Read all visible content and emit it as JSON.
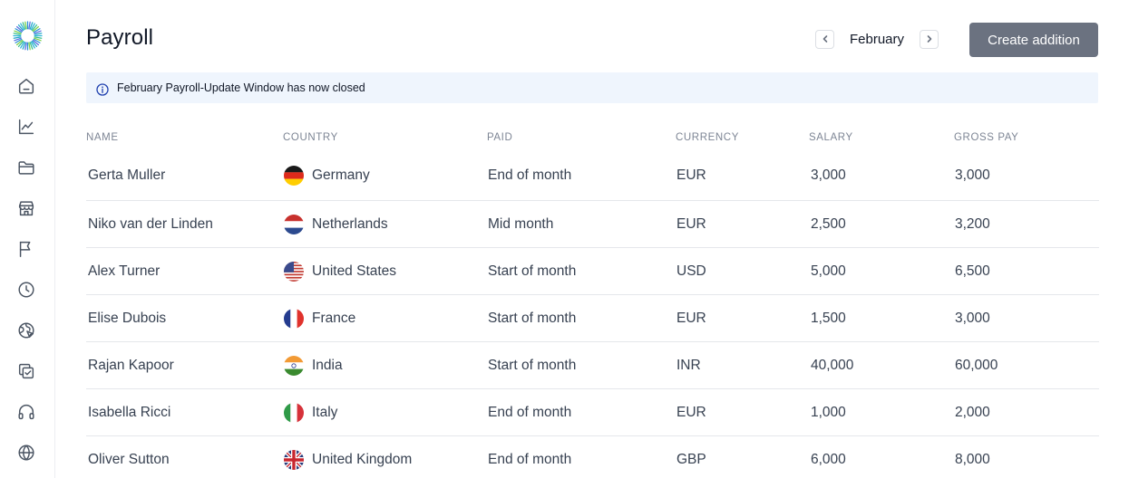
{
  "app": {
    "title": "Payroll"
  },
  "sidebar": {
    "logo": "sunburst-logo",
    "items": [
      {
        "name": "home",
        "icon": "home-icon"
      },
      {
        "name": "analytics",
        "icon": "chart-line-icon"
      },
      {
        "name": "documents",
        "icon": "folder-icon"
      },
      {
        "name": "store",
        "icon": "store-icon"
      },
      {
        "name": "flags",
        "icon": "flag-icon"
      },
      {
        "name": "time",
        "icon": "clock-icon"
      },
      {
        "name": "globe-analytics",
        "icon": "globe-pie-icon"
      },
      {
        "name": "approvals",
        "icon": "copy-check-icon"
      },
      {
        "name": "support",
        "icon": "headphones-icon"
      },
      {
        "name": "global",
        "icon": "globe-icon"
      }
    ]
  },
  "header": {
    "month": "February",
    "prev_icon": "chevron-left-icon",
    "next_icon": "chevron-right-icon",
    "create_label": "Create addition"
  },
  "banner": {
    "icon": "info-icon",
    "text": "February Payroll-Update Window has now closed"
  },
  "table": {
    "columns": [
      "NAME",
      "COUNTRY",
      "PAID",
      "CURRENCY",
      "SALARY",
      "GROSS PAY"
    ],
    "rows": [
      {
        "name": "Gerta Muller",
        "country": "Germany",
        "flag": "germany-flag",
        "paid": "End of month",
        "currency": "EUR",
        "salary": "3,000",
        "gross": "3,000"
      },
      {
        "name": "Niko van der Linden",
        "country": "Netherlands",
        "flag": "netherlands-flag",
        "paid": "Mid month",
        "currency": "EUR",
        "salary": "2,500",
        "gross": "3,200"
      },
      {
        "name": "Alex Turner",
        "country": "United States",
        "flag": "usa-flag",
        "paid": "Start of month",
        "currency": "USD",
        "salary": "5,000",
        "gross": "6,500"
      },
      {
        "name": "Elise Dubois",
        "country": "France",
        "flag": "france-flag",
        "paid": "Start of month",
        "currency": "EUR",
        "salary": "1,500",
        "gross": "3,000"
      },
      {
        "name": "Rajan Kapoor",
        "country": "India",
        "flag": "india-flag",
        "paid": "Start of month",
        "currency": "INR",
        "salary": "40,000",
        "gross": "60,000"
      },
      {
        "name": "Isabella Ricci",
        "country": "Italy",
        "flag": "italy-flag",
        "paid": "End of month",
        "currency": "EUR",
        "salary": "1,000",
        "gross": "2,000"
      },
      {
        "name": "Oliver Sutton",
        "country": "United Kingdom",
        "flag": "uk-flag",
        "paid": "End of month",
        "currency": "GBP",
        "salary": "6,000",
        "gross": "8,000"
      }
    ]
  },
  "colors": {
    "primary_button": "#6b7280",
    "banner_bg": "#eff5fd",
    "info_accent": "#1e3fae"
  }
}
